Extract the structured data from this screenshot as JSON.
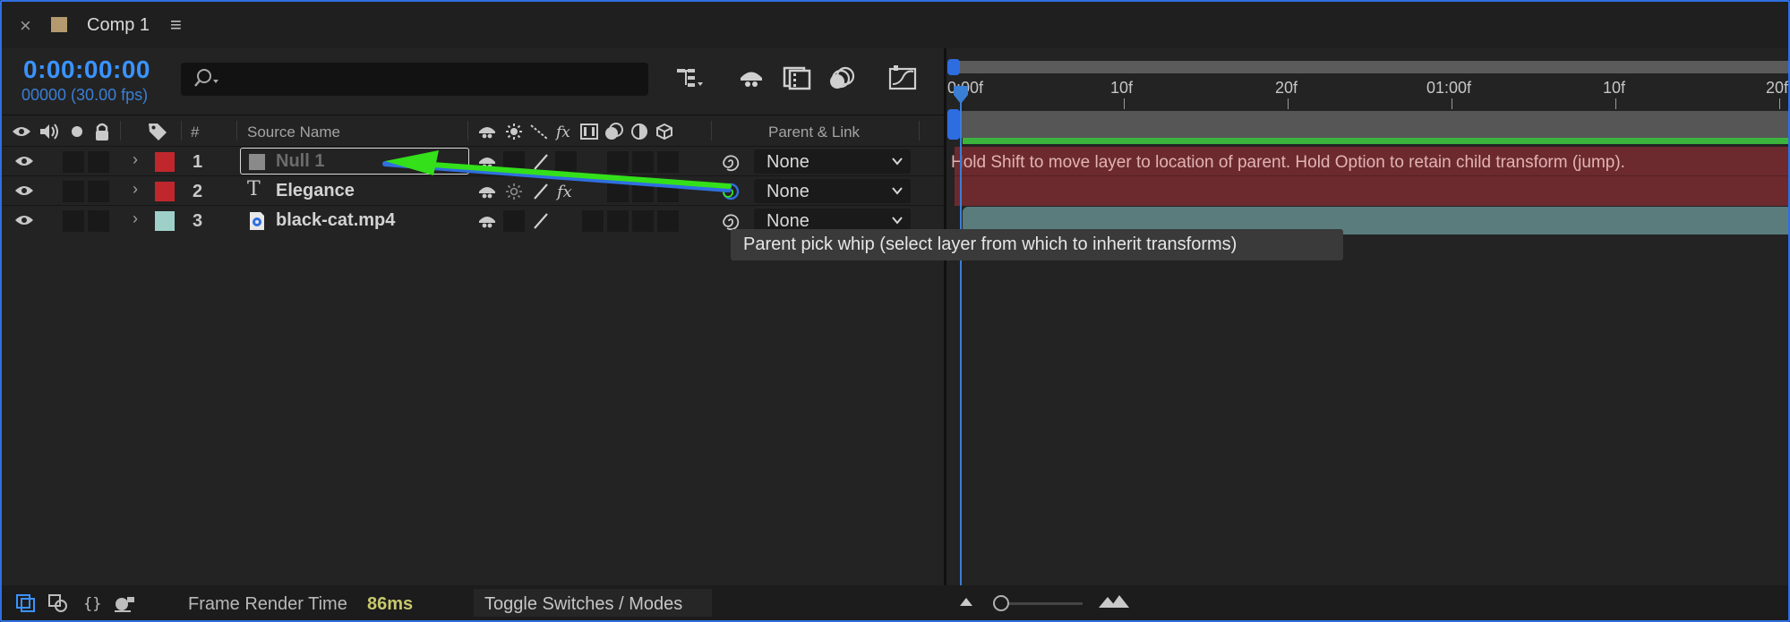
{
  "tab": {
    "close_glyph": "×",
    "title": "Comp 1",
    "menu_glyph": "≡",
    "swatch_color": "#b49a6e"
  },
  "time": {
    "timecode": "0:00:00:00",
    "frame_fps": "00000 (30.00 fps)"
  },
  "search": {
    "value": "",
    "icon": "search-dropdown-icon"
  },
  "toolbar_icons": [
    "composition-mini-flowchart-icon",
    "shy-layers-icon",
    "frame-blending-icon",
    "motion-blur-icon",
    "graph-editor-icon"
  ],
  "columns": {
    "number": "#",
    "source_name": "Source Name",
    "parent_link": "Parent & Link"
  },
  "layers": [
    {
      "number": "1",
      "name": "Null 1",
      "type": "null",
      "label_color": "#c0272d",
      "parent": "None",
      "dimmed": true,
      "fx": false
    },
    {
      "number": "2",
      "name": "Elegance",
      "type": "text",
      "type_glyph": "T",
      "label_color": "#c0272d",
      "parent": "None",
      "dimmed": false,
      "fx": true
    },
    {
      "number": "3",
      "name": "black-cat.mp4",
      "type": "footage",
      "label_color": "#9ed0c9",
      "parent": "None",
      "dimmed": false,
      "fx": false
    }
  ],
  "ruler": {
    "labels": [
      "0:00f",
      "10f",
      "20f",
      "01:00f",
      "10f",
      "20f"
    ]
  },
  "hint": "Hold Shift to move layer to location of parent. Hold Option to retain child transform (jump).",
  "tooltip": "Parent pick whip (select layer from which to inherit transforms)",
  "bottom": {
    "frame_render_label": "Frame Render Time",
    "frame_render_value": "86ms",
    "toggle_label": "Toggle Switches / Modes"
  },
  "colors": {
    "accent": "#3a93ff",
    "green_arrow": "#33e01a",
    "timeline_green": "#3cb33c",
    "frame_time": "#c7c86d"
  }
}
